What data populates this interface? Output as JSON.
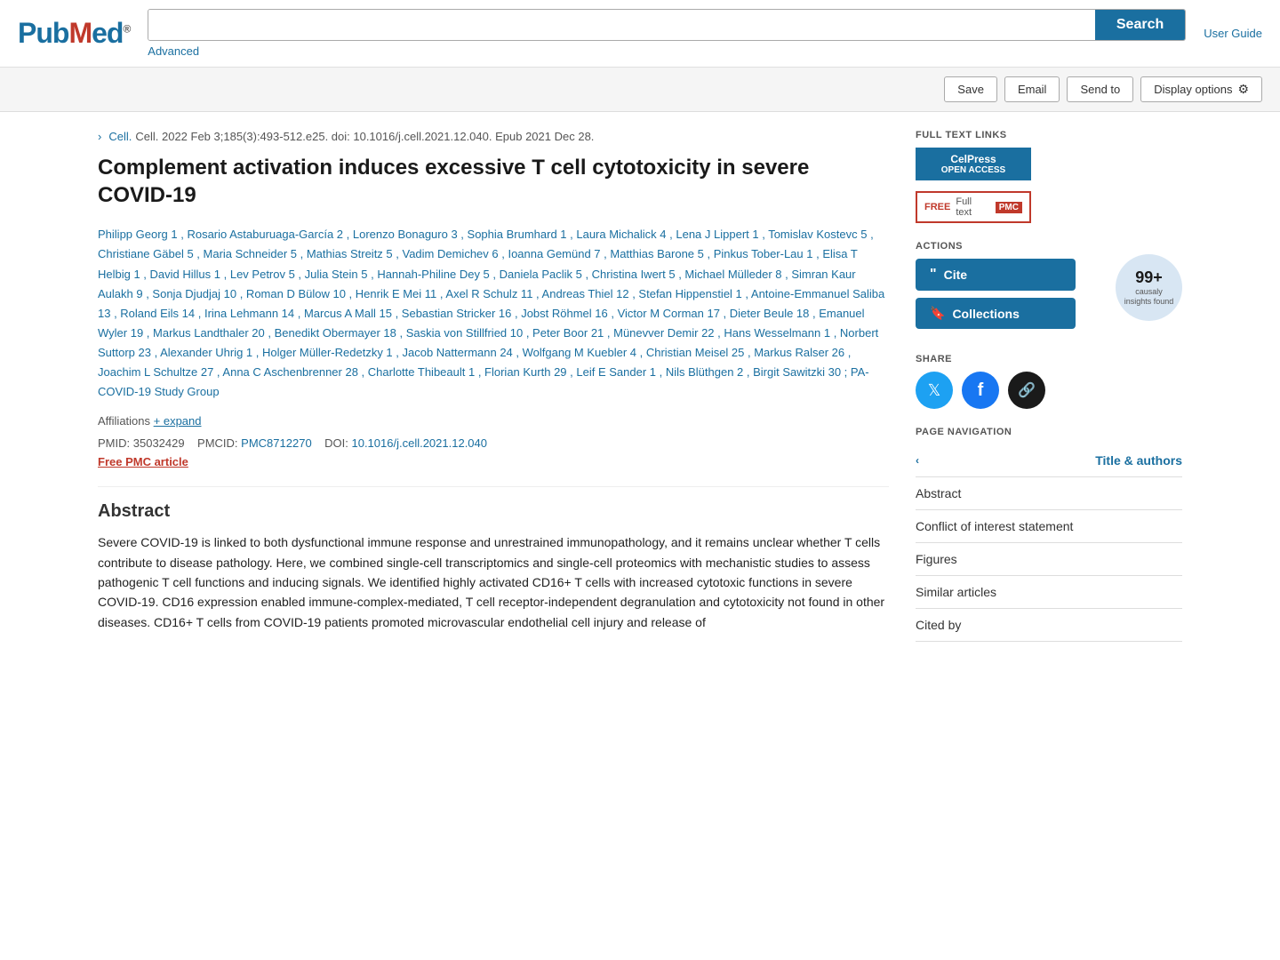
{
  "header": {
    "logo_main": "PubMed",
    "logo_reg": "®",
    "search_placeholder": "",
    "search_button": "Search",
    "advanced_link": "Advanced",
    "user_guide_link": "User Guide"
  },
  "toolbar": {
    "save_label": "Save",
    "email_label": "Email",
    "send_to_label": "Send to",
    "display_options_label": "Display options"
  },
  "article": {
    "citation": "Cell. 2022 Feb 3;185(3):493-512.e25. doi: 10.1016/j.cell.2021.12.040. Epub 2021 Dec 28.",
    "journal": "Cell",
    "title": "Complement activation induces excessive T cell cytotoxicity in severe COVID-19",
    "authors": "Philipp Georg 1 , Rosario Astaburuaga-García 2 , Lorenzo Bonaguro 3 , Sophia Brumhard 1 , Laura Michalick 4 , Lena J Lippert 1 , Tomislav Kostevc 5 , Christiane Gäbel 5 , Maria Schneider 5 , Mathias Streitz 5 , Vadim Demichev 6 , Ioanna Gemünd 7 , Matthias Barone 5 , Pinkus Tober-Lau 1 , Elisa T Helbig 1 , David Hillus 1 , Lev Petrov 5 , Julia Stein 5 , Hannah-Philine Dey 5 , Daniela Paclik 5 , Christina Iwert 5 , Michael Mülleder 8 , Simran Kaur Aulakh 9 , Sonja Djudjaj 10 , Roman D Bülow 10 , Henrik E Mei 11 , Axel R Schulz 11 , Andreas Thiel 12 , Stefan Hippenstiel 1 , Antoine-Emmanuel Saliba 13 , Roland Eils 14 , Irina Lehmann 14 , Marcus A Mall 15 , Sebastian Stricker 16 , Jobst Röhmel 16 , Victor M Corman 17 , Dieter Beule 18 , Emanuel Wyler 19 , Markus Landthaler 20 , Benedikt Obermayer 18 , Saskia von Stillfried 10 , Peter Boor 21 , Münevver Demir 22 , Hans Wesselmann 1 , Norbert Suttorp 23 , Alexander Uhrig 1 , Holger Müller-Redetzky 1 , Jacob Nattermann 24 , Wolfgang M Kuebler 4 , Christian Meisel 25 , Markus Ralser 26 , Joachim L Schultze 27 , Anna C Aschenbrenner 28 , Charlotte Thibeault 1 , Florian Kurth 29 , Leif E Sander 1 , Nils Blüthgen 2 , Birgit Sawitzki 30 ; PA-COVID-19 Study Group",
    "affiliations_text": "Affiliations",
    "affiliations_expand": "+ expand",
    "pmid_label": "PMID:",
    "pmid_value": "35032429",
    "pmcid_label": "PMCID:",
    "pmcid_value": "PMC8712270",
    "doi_label": "DOI:",
    "doi_value": "10.1016/j.cell.2021.12.040",
    "free_pmc": "Free PMC article",
    "abstract_title": "Abstract",
    "abstract_text": "Severe COVID-19 is linked to both dysfunctional immune response and unrestrained immunopathology, and it remains unclear whether T cells contribute to disease pathology. Here, we combined single-cell transcriptomics and single-cell proteomics with mechanistic studies to assess pathogenic T cell functions and inducing signals. We identified highly activated CD16+ T cells with increased cytotoxic functions in severe COVID-19. CD16 expression enabled immune-complex-mediated, T cell receptor-independent degranulation and cytotoxicity not found in other diseases. CD16+ T cells from COVID-19 patients promoted microvascular endothelial cell injury and release of"
  },
  "sidebar": {
    "full_text_label": "FULL TEXT LINKS",
    "celpress_label": "CelPress",
    "celpress_sub": "OPEN ACCESS",
    "pmc_free": "FREE",
    "pmc_full_text": "Full text",
    "pmc_label": "PMC",
    "actions_label": "ACTIONS",
    "cite_label": "Cite",
    "collections_label": "Collections",
    "causaly_count": "99+",
    "causaly_label": "causaly\ninsights found",
    "share_label": "SHARE",
    "page_nav_label": "PAGE NAVIGATION",
    "nav_items": [
      {
        "label": "Title & authors",
        "active": true,
        "has_arrow": true
      },
      {
        "label": "Abstract",
        "active": false,
        "has_arrow": false
      },
      {
        "label": "Conflict of interest statement",
        "active": false,
        "has_arrow": false
      },
      {
        "label": "Figures",
        "active": false,
        "has_arrow": false
      },
      {
        "label": "Similar articles",
        "active": false,
        "has_arrow": false
      },
      {
        "label": "Cited by",
        "active": false,
        "has_arrow": false
      }
    ]
  }
}
